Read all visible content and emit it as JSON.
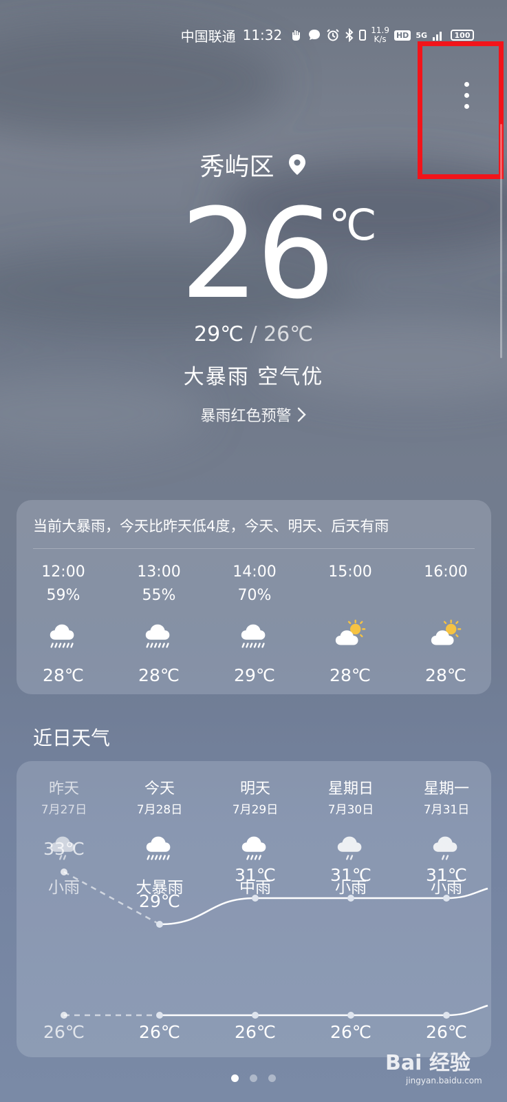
{
  "status_bar": {
    "carrier": "中国联通",
    "time": "11:32",
    "net_speed_value": "11.9",
    "net_speed_unit": "K/s",
    "hd": "HD",
    "network": "5G",
    "battery": "100"
  },
  "header": {
    "location": "秀屿区",
    "temperature": "26",
    "unit": "℃",
    "high": "29℃",
    "low": "26℃",
    "range_sep": " / ",
    "condition": "大暴雨  空气优",
    "alert": "暴雨红色预警"
  },
  "hourly": {
    "summary": "当前大暴雨，今天比昨天低4度，今天、明天、后天有雨",
    "items": [
      {
        "time": "12:00",
        "precip": "59%",
        "icon": "heavy-rain-icon",
        "temp": "28℃"
      },
      {
        "time": "13:00",
        "precip": "55%",
        "icon": "heavy-rain-icon",
        "temp": "28℃"
      },
      {
        "time": "14:00",
        "precip": "70%",
        "icon": "heavy-rain-icon",
        "temp": "29℃"
      },
      {
        "time": "15:00",
        "precip": "",
        "icon": "partly-cloudy-icon",
        "temp": "28℃"
      },
      {
        "time": "16:00",
        "precip": "",
        "icon": "partly-cloudy-icon",
        "temp": "28℃"
      }
    ]
  },
  "daily": {
    "title": "近日天气",
    "items": [
      {
        "name": "昨天",
        "date": "7月27日",
        "icon": "light-rain-icon",
        "cond": "小雨",
        "high": "33℃",
        "low": "26℃",
        "high_value": 33,
        "low_value": 26
      },
      {
        "name": "今天",
        "date": "7月28日",
        "icon": "heavy-rain-icon",
        "cond": "大暴雨",
        "high": "29℃",
        "low": "26℃",
        "high_value": 29,
        "low_value": 26
      },
      {
        "name": "明天",
        "date": "7月29日",
        "icon": "moderate-rain-icon",
        "cond": "中雨",
        "high": "31℃",
        "low": "26℃",
        "high_value": 31,
        "low_value": 26
      },
      {
        "name": "星期日",
        "date": "7月30日",
        "icon": "light-rain-icon",
        "cond": "小雨",
        "high": "31℃",
        "low": "26℃",
        "high_value": 31,
        "low_value": 26
      },
      {
        "name": "星期一",
        "date": "7月31日",
        "icon": "light-rain-icon",
        "cond": "小雨",
        "high": "31℃",
        "low": "26℃",
        "high_value": 31,
        "low_value": 26
      }
    ]
  },
  "pager": {
    "pages": 3,
    "current": 1
  },
  "watermark": {
    "brand": "Bai 经验",
    "url": "jingyan.baidu.com"
  },
  "colors": {
    "accent_highlight": "#f2141a",
    "sun": "#f6c343"
  }
}
